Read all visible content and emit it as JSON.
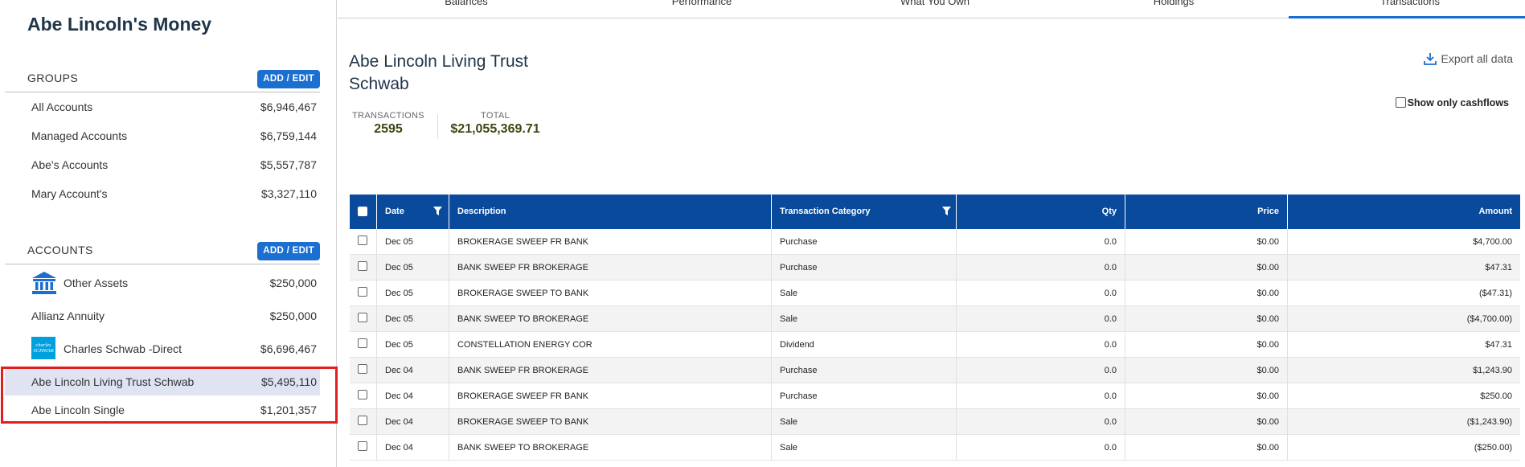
{
  "app_title": "Abe Lincoln's Money",
  "groups": {
    "label": "GROUPS",
    "button": "ADD / EDIT",
    "items": [
      {
        "name": "All Accounts",
        "value": "$6,946,467"
      },
      {
        "name": "Managed Accounts",
        "value": "$6,759,144"
      },
      {
        "name": "Abe's Accounts",
        "value": "$5,557,787"
      },
      {
        "name": "Mary Account's",
        "value": "$3,327,110"
      }
    ]
  },
  "accounts": {
    "label": "ACCOUNTS",
    "button": "ADD / EDIT",
    "items": [
      {
        "name": "Other Assets",
        "value": "$250,000",
        "icon": "bank-icon"
      },
      {
        "name": "Allianz Annuity",
        "value": "$250,000"
      },
      {
        "name": "Charles Schwab -Direct",
        "value": "$6,696,467",
        "icon": "charles-schwab-logo",
        "logo_text": "charles SCHWAB"
      },
      {
        "name": "Abe Lincoln Living Trust Schwab",
        "value": "$5,495,110",
        "selected": true
      },
      {
        "name": "Abe Lincoln Single",
        "value": "$1,201,357"
      }
    ]
  },
  "tabs": [
    {
      "label": "Balances"
    },
    {
      "label": "Performance"
    },
    {
      "label": "What You Own"
    },
    {
      "label": "Holdings"
    },
    {
      "label": "Transactions",
      "active": true
    }
  ],
  "account_title": {
    "line1": "Abe Lincoln Living Trust",
    "line2": "Schwab"
  },
  "stats": {
    "transactions_label": "TRANSACTIONS",
    "transactions_value": "2595",
    "total_label": "TOTAL",
    "total_value": "$21,055,369.71"
  },
  "export_label": "Export all data",
  "cashflow_label": "Show only cashflows",
  "accent_color": "#1b6fd0",
  "header_color": "#0a4a9c",
  "table": {
    "columns": [
      "Date",
      "Description",
      "Transaction Category",
      "Qty",
      "Price",
      "Amount"
    ],
    "rows": [
      {
        "date": "Dec 05",
        "desc": "BROKERAGE SWEEP FR BANK",
        "cat": "Purchase",
        "qty": "0.0",
        "price": "$0.00",
        "amount": "$4,700.00"
      },
      {
        "date": "Dec 05",
        "desc": "BANK SWEEP FR BROKERAGE",
        "cat": "Purchase",
        "qty": "0.0",
        "price": "$0.00",
        "amount": "$47.31"
      },
      {
        "date": "Dec 05",
        "desc": "BROKERAGE SWEEP TO BANK",
        "cat": "Sale",
        "qty": "0.0",
        "price": "$0.00",
        "amount": "($47.31)"
      },
      {
        "date": "Dec 05",
        "desc": "BANK SWEEP TO BROKERAGE",
        "cat": "Sale",
        "qty": "0.0",
        "price": "$0.00",
        "amount": "($4,700.00)"
      },
      {
        "date": "Dec 05",
        "desc": "CONSTELLATION ENERGY COR",
        "cat": "Dividend",
        "qty": "0.0",
        "price": "$0.00",
        "amount": "$47.31"
      },
      {
        "date": "Dec 04",
        "desc": "BANK SWEEP FR BROKERAGE",
        "cat": "Purchase",
        "qty": "0.0",
        "price": "$0.00",
        "amount": "$1,243.90"
      },
      {
        "date": "Dec 04",
        "desc": "BROKERAGE SWEEP FR BANK",
        "cat": "Purchase",
        "qty": "0.0",
        "price": "$0.00",
        "amount": "$250.00"
      },
      {
        "date": "Dec 04",
        "desc": "BROKERAGE SWEEP TO BANK",
        "cat": "Sale",
        "qty": "0.0",
        "price": "$0.00",
        "amount": "($1,243.90)"
      },
      {
        "date": "Dec 04",
        "desc": "BANK SWEEP TO BROKERAGE",
        "cat": "Sale",
        "qty": "0.0",
        "price": "$0.00",
        "amount": "($250.00)"
      }
    ]
  }
}
